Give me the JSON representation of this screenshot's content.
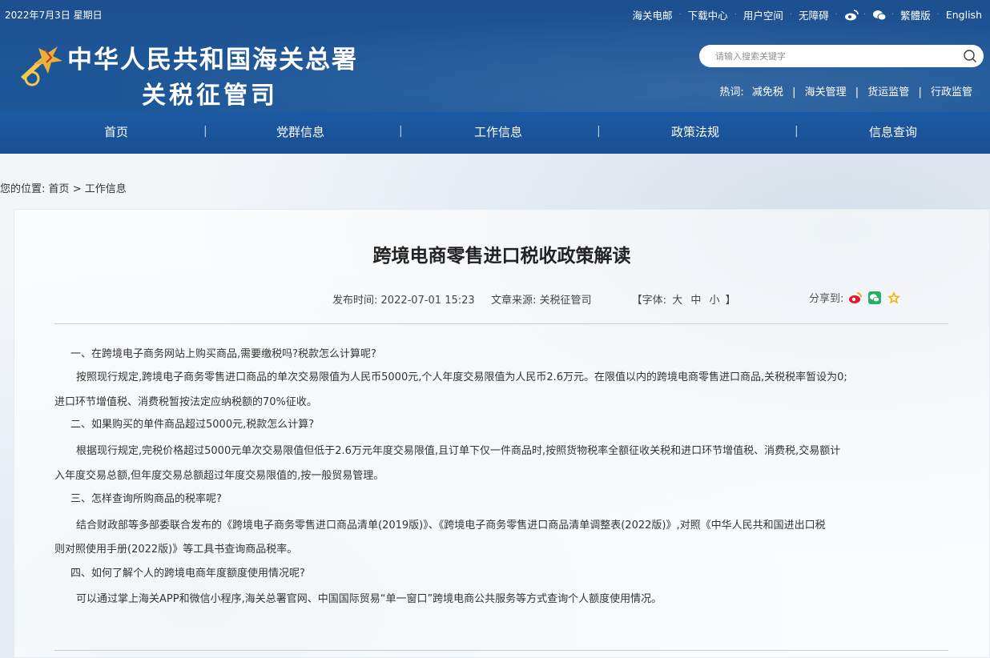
{
  "topbar": {
    "date": "2022年7月3日 星期日",
    "links": [
      "海关电邮",
      "下载中心",
      "用户空间",
      "无障碍"
    ],
    "links2": [
      "繁體版",
      "English"
    ]
  },
  "header": {
    "title_line1": "中华人民共和国海关总署",
    "title_line2": "关税征管司",
    "search_placeholder": "请输入搜索关键字",
    "hot_label": "热词:",
    "hot_words": [
      "减免税",
      "海关管理",
      "货运监管",
      "行政监管"
    ],
    "hot_sep": "|"
  },
  "nav": {
    "items": [
      "首页",
      "党群信息",
      "工作信息",
      "政策法规",
      "信息查询"
    ],
    "sep": "|"
  },
  "breadcrumb": {
    "label": "您的位置:",
    "home": "首页",
    "arrow": ">",
    "current": "工作信息"
  },
  "article": {
    "title": "跨境电商零售进口税收政策解读",
    "publish_label": "发布时间:",
    "publish_time": "2022-07-01 15:23",
    "source_label": "文章来源:",
    "source": "关税征管司",
    "font_open": "【字体:",
    "font_large": "大",
    "font_medium": "中",
    "font_small": "小",
    "font_close": "】",
    "share_label": "分享到:",
    "paragraphs": [
      "一、在跨境电子商务网站上购买商品,需要缴税吗?税款怎么计算呢?",
      "按照现行规定,跨境电子商务零售进口商品的单次交易限值为人民币5000元,个人年度交易限值为人民币2.6万元。在限值以内的跨境电商零售进口商品,关税税率暂设为0;",
      "进口环节增值税、消费税暂按法定应纳税额的70%征收。",
      "二、如果购买的单件商品超过5000元,税款怎么计算?",
      "根据现行规定,完税价格超过5000元单次交易限值但低于2.6万元年度交易限值,且订单下仅一件商品时,按照货物税率全额征收关税和进口环节增值税、消费税,交易额计",
      "入年度交易总额,但年度交易总额超过年度交易限值的,按一般贸易管理。",
      "三、怎样查询所购商品的税率呢?",
      "结合财政部等多部委联合发布的《跨境电子商务零售进口商品清单(2019版)》、《跨境电子商务零售进口商品清单调整表(2022版)》,对照《中华人民共和国进出口税",
      "则对照使用手册(2022版)》等工具书查询商品税率。",
      "四、如何了解个人的跨境电商年度额度使用情况呢?",
      "可以通过掌上海关APP和微信小程序,海关总署官网、中国国际贸易“单一窗口”跨境电商公共服务等方式查询个人额度使用情况。"
    ]
  },
  "icons": [
    "emblem-logo",
    "weibo-icon",
    "wechat-icon",
    "search-icon",
    "favorite-star-icon"
  ],
  "colors": {
    "header_blue": "#1d4f8e",
    "nav_blue": "#1b4f92",
    "text": "#333333"
  }
}
